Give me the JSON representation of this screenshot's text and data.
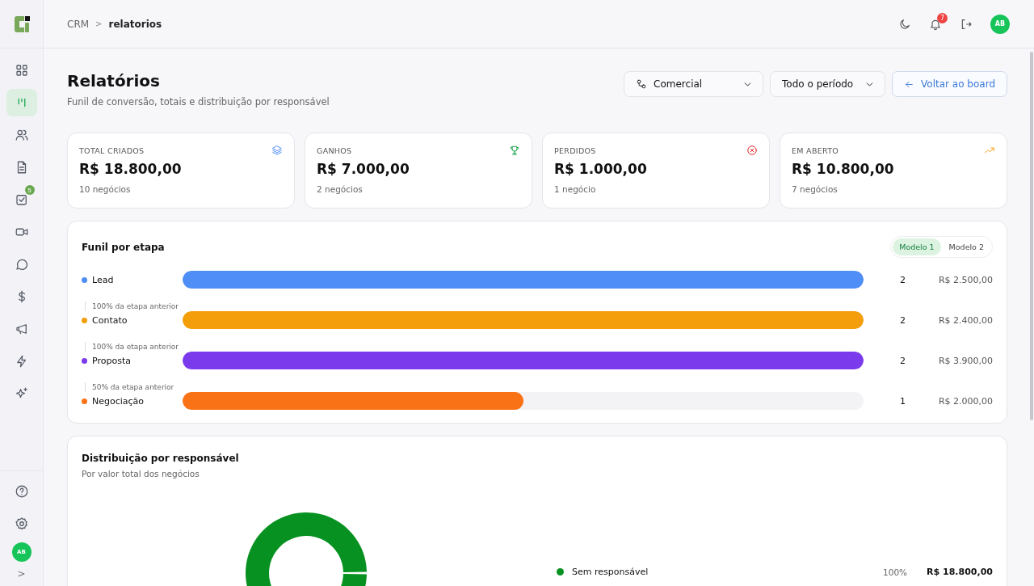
{
  "sidebar": {
    "items": [
      {
        "kind": "grid",
        "selected": false
      },
      {
        "kind": "board",
        "selected": true
      },
      {
        "kind": "users",
        "selected": false
      },
      {
        "kind": "document",
        "selected": false
      },
      {
        "kind": "task",
        "selected": false,
        "badge": "5"
      },
      {
        "kind": "video",
        "selected": false
      },
      {
        "kind": "chat",
        "selected": false
      },
      {
        "kind": "dollar",
        "selected": false
      },
      {
        "kind": "megaphone",
        "selected": false
      },
      {
        "kind": "zap",
        "selected": false
      },
      {
        "kind": "sparkles",
        "selected": false
      }
    ],
    "bottom": [
      {
        "kind": "help"
      },
      {
        "kind": "settings"
      }
    ],
    "avatar": "AB",
    "expand": ">"
  },
  "header": {
    "breadcrumb": [
      "CRM",
      "relatorios"
    ],
    "separator": ">",
    "notifications": "7",
    "avatar": "AB"
  },
  "page": {
    "title": "Relatórios",
    "subtitle": "Funil de conversão, totais e distribuição por responsável",
    "pipeline": "Comercial",
    "period": "Todo o período",
    "back": "Voltar ao board"
  },
  "stats": [
    {
      "kind": "total",
      "label": "TOTAL CRIADOS",
      "value": "R$ 18.800,00",
      "count": "10 negócios"
    },
    {
      "kind": "won",
      "label": "GANHOS",
      "value": "R$ 7.000,00",
      "count": "2 negócios"
    },
    {
      "kind": "lost",
      "label": "PERDIDOS",
      "value": "R$ 1.000,00",
      "count": "1 negócio"
    },
    {
      "kind": "open",
      "label": "EM ABERTO",
      "value": "R$ 10.800,00",
      "count": "7 negócios"
    }
  ],
  "funnel": {
    "title": "Funil por etapa",
    "models": [
      {
        "label": "Modelo 1",
        "selected": true
      },
      {
        "label": "Modelo 2",
        "selected": false
      }
    ],
    "stages": [
      {
        "name": "Lead",
        "color": "#4f8ef7",
        "level": 1,
        "count": "2",
        "value": "R$ 2.500,00"
      },
      {
        "name": "Contato",
        "color": "#f59e0b",
        "level": 1,
        "count": "2",
        "value": "R$ 2.400,00",
        "conversion": "100% da etapa anterior"
      },
      {
        "name": "Proposta",
        "color": "#7c3aed",
        "level": 1,
        "count": "2",
        "value": "R$ 3.900,00",
        "conversion": "100% da etapa anterior"
      },
      {
        "name": "Negociação",
        "color": "#f97316",
        "level": 0.5,
        "count": "1",
        "value": "R$ 2.000,00",
        "conversion": "50% da etapa anterior"
      }
    ]
  },
  "distribution": {
    "title": "Distribuição por responsável",
    "subtitle": "Por valor total dos negócios",
    "legend": [
      {
        "name": "Sem responsável",
        "color": "#079120",
        "share": "100%",
        "value": "R$ 18.800,00"
      }
    ]
  }
}
